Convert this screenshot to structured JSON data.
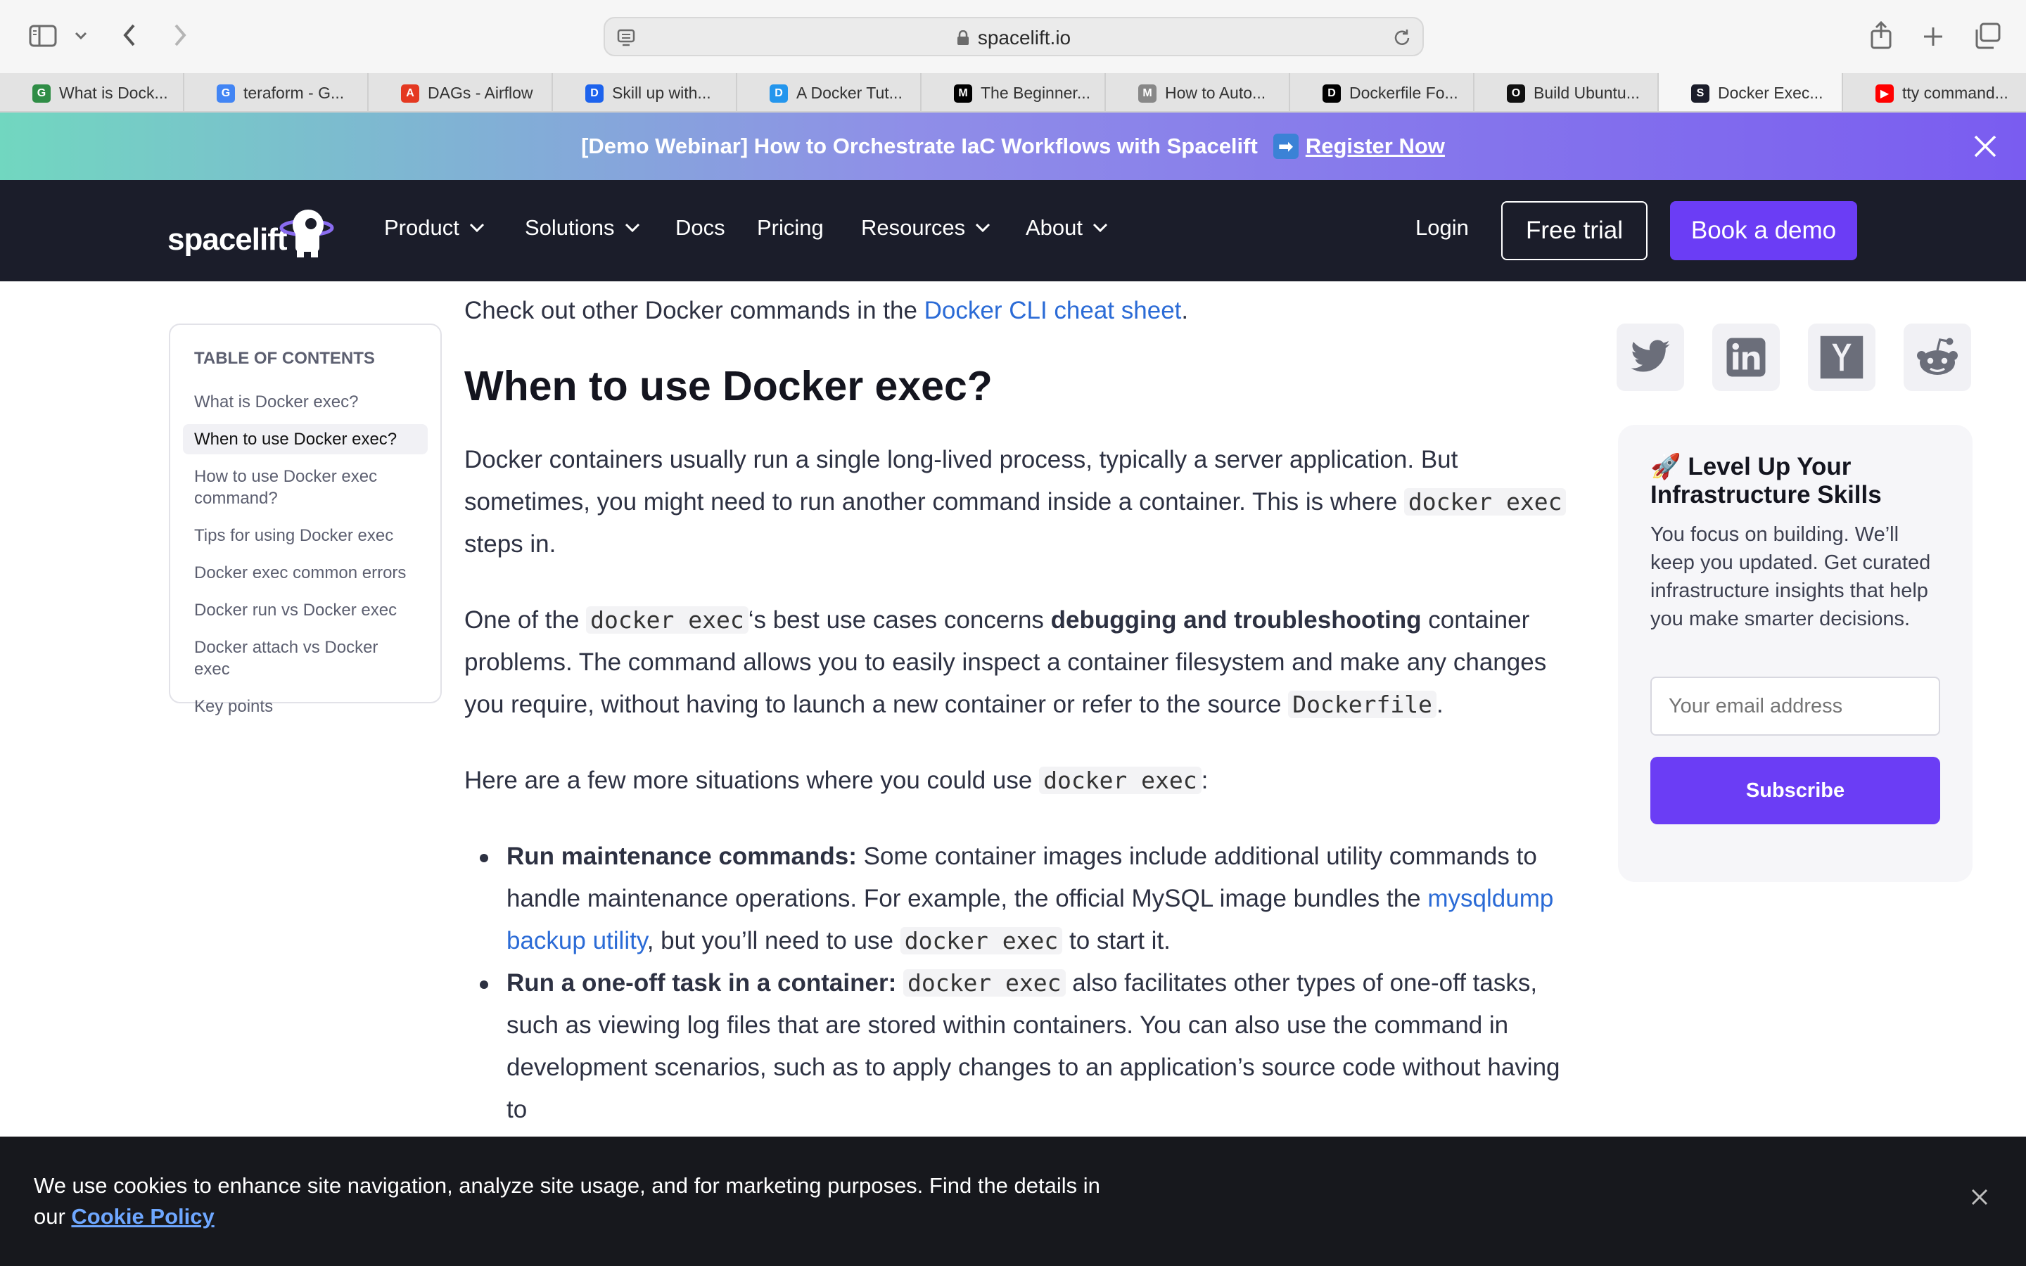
{
  "browser": {
    "url": "spacelift.io",
    "tabs": [
      {
        "label": "What is Dock...",
        "favicon": "gfg-icon",
        "color": "#2f8d46",
        "glyph": "G"
      },
      {
        "label": "teraform - G...",
        "favicon": "google-icon",
        "color": "#4285f4",
        "glyph": "G"
      },
      {
        "label": "DAGs - Airflow",
        "favicon": "airflow-icon",
        "color": "#e43921",
        "glyph": "A"
      },
      {
        "label": "Skill up with...",
        "favicon": "docker-icon",
        "color": "#1d63ed",
        "glyph": "D"
      },
      {
        "label": "A Docker Tut...",
        "favicon": "docker-whale-icon",
        "color": "#2496ed",
        "glyph": "D"
      },
      {
        "label": "The Beginner...",
        "favicon": "medium-icon",
        "color": "#000000",
        "glyph": "M"
      },
      {
        "label": "How to Auto...",
        "favicon": "m-icon",
        "color": "#888888",
        "glyph": "M"
      },
      {
        "label": "Dockerfile Fo...",
        "favicon": "dev-icon",
        "color": "#000000",
        "glyph": "D"
      },
      {
        "label": "Build Ubuntu...",
        "favicon": "openai-icon",
        "color": "#111111",
        "glyph": "O"
      },
      {
        "label": "Docker Exec...",
        "favicon": "spacelift-icon",
        "color": "#1b1d2a",
        "glyph": "S",
        "active": true
      },
      {
        "label": "tty command...",
        "favicon": "youtube-icon",
        "color": "#ff0000",
        "glyph": "▶"
      }
    ]
  },
  "promo": {
    "text": "[Demo Webinar] How to Orchestrate IaC Workflows with Spacelift",
    "arrow": "➡",
    "link": "Register Now"
  },
  "nav": {
    "logo": "spacelift",
    "items": [
      {
        "label": "Product",
        "dropdown": true
      },
      {
        "label": "Solutions",
        "dropdown": true
      },
      {
        "label": "Docs",
        "dropdown": false
      },
      {
        "label": "Pricing",
        "dropdown": false
      },
      {
        "label": "Resources",
        "dropdown": true
      },
      {
        "label": "About",
        "dropdown": true
      }
    ],
    "login": "Login",
    "trial": "Free trial",
    "demo": "Book a demo"
  },
  "toc": {
    "title": "TABLE OF CONTENTS",
    "items": [
      "What is Docker exec?",
      "When to use Docker exec?",
      "How to use Docker exec command?",
      "Tips for using Docker exec",
      "Docker exec common errors",
      "Docker run vs Docker exec",
      "Docker attach vs Docker exec",
      "Key points"
    ],
    "active_index": 1
  },
  "article": {
    "intro_prefix": "Check out other Docker commands in the ",
    "intro_link": "Docker CLI cheat sheet",
    "intro_suffix": ".",
    "heading": "When to use Docker exec?",
    "p1_a": "Docker containers usually run a single long-lived process, typically a server application. But sometimes, you might need to run another command inside a container. This is where ",
    "p1_code": "docker exec",
    "p1_b": " steps in.",
    "p2_a": "One of the ",
    "p2_code": "docker exec",
    "p2_b": "‘s best use cases concerns ",
    "p2_bold": "debugging and troubleshooting",
    "p2_c": " container problems. The command allows you to easily inspect a container filesystem and make any changes you require, without having to launch a new container or refer to the source ",
    "p2_code2": "Dockerfile",
    "p2_d": ".",
    "p3_a": "Here are a few more situations where you could use ",
    "p3_code": "docker exec",
    "p3_b": ":",
    "li1_bold": "Run maintenance commands:",
    "li1_a": " Some container images include additional utility commands to handle maintenance operations. For example, the official MySQL image bundles the ",
    "li1_link": "mysqldump backup utility",
    "li1_b": ", but you’ll need to use ",
    "li1_code": "docker exec",
    "li1_c": " to start it.",
    "li2_bold": "Run a one-off task in a container:",
    "li2_code": "docker exec",
    "li2_a": " also facilitates other types of one-off tasks, such as viewing log files that are stored within containers. You can also use the command in development scenarios, such as to apply changes to an application’s source code without having to"
  },
  "share": {
    "icons": [
      "twitter-icon",
      "linkedin-icon",
      "hackernews-icon",
      "reddit-icon"
    ]
  },
  "newsletter": {
    "emoji": "🚀",
    "title": "Level Up Your Infrastructure Skills",
    "desc": "You focus on building. We’ll keep you updated. Get curated infrastructure insights that help you make smarter decisions.",
    "placeholder": "Your email address",
    "button": "Subscribe"
  },
  "cookie": {
    "text": "We use cookies to enhance site navigation, analyze site usage, and for marketing purposes. Find the details in our ",
    "link": "Cookie Policy"
  },
  "colors": {
    "accent": "#6b3df5",
    "nav_bg": "#1b1d2a",
    "link": "#2b6bd6"
  }
}
